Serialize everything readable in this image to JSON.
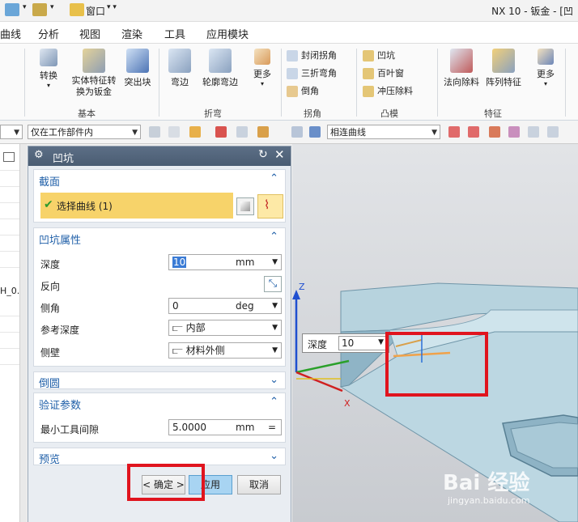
{
  "window": {
    "title": "NX 10 - 钣金 - [凹"
  },
  "quickaccess": {
    "window_menu": "窗口"
  },
  "menubar": {
    "items": [
      "曲线",
      "分析",
      "视图",
      "渲染",
      "工具",
      "应用模块"
    ]
  },
  "ribbon": {
    "buttons": {
      "convert": "转换",
      "solid_to_sheet": "实体特征转换为钣金",
      "tab": "突出块",
      "flange": "弯边",
      "contour_flange": "轮廓弯边",
      "more1": "更多",
      "closed_corner": "封闭拐角",
      "three_bend_corner": "三折弯角",
      "chamfer": "倒角",
      "dimple": "凹坑",
      "louver": "百叶窗",
      "drawn_cutout": "冲压除料",
      "normal_cutout": "法向除料",
      "pattern_feature": "阵列特征",
      "more2": "更多"
    },
    "groups": {
      "basic": "基本",
      "bend": "折弯",
      "corner": "拐角",
      "emboss": "凸模",
      "feature": "特征"
    }
  },
  "filterbar": {
    "scope": "仅在工作部件内",
    "curve_rule": "相连曲线"
  },
  "leftstrip": {
    "partial_text": "H_0."
  },
  "dialog": {
    "title": "凹坑",
    "section": {
      "title": "截面",
      "select_curve": "选择曲线 (1)"
    },
    "properties": {
      "title": "凹坑属性",
      "depth_label": "深度",
      "depth_value": "10",
      "depth_unit": "mm",
      "reverse_label": "反向",
      "side_angle_label": "侧角",
      "side_angle_value": "0",
      "side_angle_unit": "deg",
      "ref_depth_label": "参考深度",
      "ref_depth_value": "内部",
      "side_wall_label": "侧壁",
      "side_wall_value": "材料外侧"
    },
    "round": {
      "title": "倒圆"
    },
    "validation": {
      "title": "验证参数",
      "min_tool_label": "最小工具间隙",
      "min_tool_value": "5.0000",
      "min_tool_unit": "mm"
    },
    "preview": {
      "title": "预览"
    },
    "buttons": {
      "ok": "< 确定 >",
      "apply": "应用",
      "cancel": "取消"
    }
  },
  "viewport": {
    "axis_z": "Z",
    "axis_x": "X",
    "depth_label": "深度",
    "depth_value": "10",
    "watermark": "Bai 经验",
    "watermark_url": "jingyan.baidu.com"
  },
  "colors": {
    "highlight": "#f7d36a",
    "red_annotation": "#e0141e",
    "section_title": "#1f5fa8",
    "apply_button": "#a8d4f2"
  }
}
